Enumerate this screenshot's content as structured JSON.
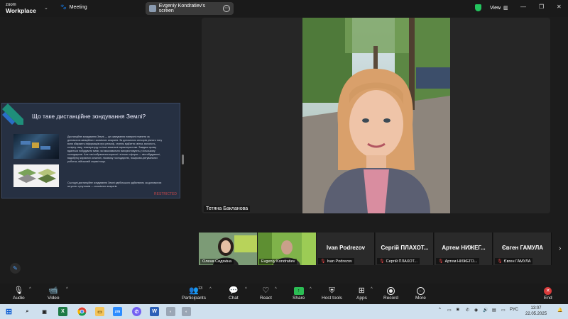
{
  "app": {
    "logo_line1": "zoom",
    "logo_line2": "Workplace"
  },
  "topbar": {
    "meeting_label": "Meeting",
    "share_label": "Evgeniy Kondratiev's screen",
    "view_label": "View"
  },
  "slide": {
    "title": "Що таке дистанційне зондування Землі?",
    "body": "Дистанційне зондування Землі — це сканування поверхні планети за допомогою авіаційних і космічних апаратів. За допомогою сенсорів різного типу вони збирають інформацію про рельєф, ступінь відбиття світла, вологість, колірну гаму, температуру та інші земельні характеристики. Завдяки цьому вдається побудувати мапи, які максимально використовують у сільському господарстві. Але такі зображення корисні і в інших сферах — містобудуванні, видобутку корисних копалин, лісовому господарстві, пошуково-рятувальних роботах, військовій справі тощо.",
    "body2": "Сьогодні дистанційне зондування Землі здебільшого здійснюють за допомогою штучних супутників — космічних апаратів.",
    "badge": "RESTRICTED"
  },
  "main_video": {
    "name": "Тетяна Бакланова"
  },
  "thumbnails": [
    {
      "name": "Олена Сидякіна",
      "big": "",
      "muted": false
    },
    {
      "name": "Evgeniy Kondratiev",
      "big": "",
      "muted": false
    },
    {
      "name": "Ivan Podrezov",
      "big": "Ivan Podrezov",
      "muted": true
    },
    {
      "name": "Сергій ПЛАХОТ...",
      "big": "Сергій ПЛАХОТ...",
      "muted": true
    },
    {
      "name": "Артем НИЖЕГО...",
      "big": "Артем НИЖЕГ...",
      "muted": true
    },
    {
      "name": "Євген ГАМУЛА",
      "big": "Євген ГАМУЛА",
      "muted": true
    }
  ],
  "toolbar": {
    "audio": "Audio",
    "video": "Video",
    "participants": "Participants",
    "participants_count": "13",
    "chat": "Chat",
    "react": "React",
    "share": "Share",
    "host_tools": "Host tools",
    "apps": "Apps",
    "record": "Record",
    "more": "More",
    "end": "End"
  },
  "taskbar": {
    "lang": "РУС",
    "time": "13:07",
    "date": "22.05.2025"
  },
  "colors": {
    "share_green": "#2bbd54",
    "end_red": "#d93b3b",
    "security_green": "#23c55e",
    "restricted_red": "#c2464a"
  }
}
